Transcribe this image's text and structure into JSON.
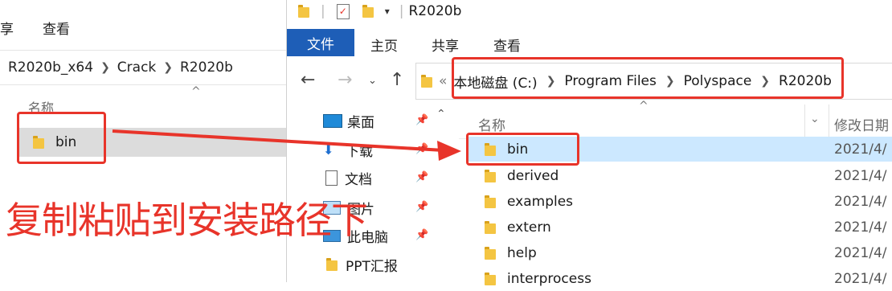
{
  "left_window": {
    "ribbon_tabs": [
      "享",
      "查看"
    ],
    "breadcrumb": [
      "R2020b_x64",
      "Crack",
      "R2020b"
    ],
    "header_name": "名称",
    "row": "bin"
  },
  "right_window": {
    "title": "R2020b",
    "ribbon": {
      "file": "文件",
      "tabs": [
        "主页",
        "共享",
        "查看"
      ]
    },
    "address": {
      "prefix": "«",
      "crumbs": [
        "本地磁盘 (C:)",
        "Program Files",
        "Polyspace",
        "R2020b"
      ]
    },
    "nav_items": [
      "桌面",
      "下载",
      "文档",
      "图片",
      "此电脑",
      "PPT汇报"
    ],
    "columns": {
      "name": "名称",
      "date": "修改日期"
    },
    "files": [
      {
        "name": "bin",
        "date": "2021/4/",
        "selected": true
      },
      {
        "name": "derived",
        "date": "2021/4/"
      },
      {
        "name": "examples",
        "date": "2021/4/"
      },
      {
        "name": "extern",
        "date": "2021/4/"
      },
      {
        "name": "help",
        "date": "2021/4/"
      },
      {
        "name": "interprocess",
        "date": "2021/4/"
      }
    ]
  },
  "annotation": {
    "text": "复制粘贴到安装路径下",
    "color": "#e8342a"
  },
  "colors": {
    "accent": "#1e5eb7",
    "selection": "#cce8ff",
    "annotation": "#e8342a"
  }
}
